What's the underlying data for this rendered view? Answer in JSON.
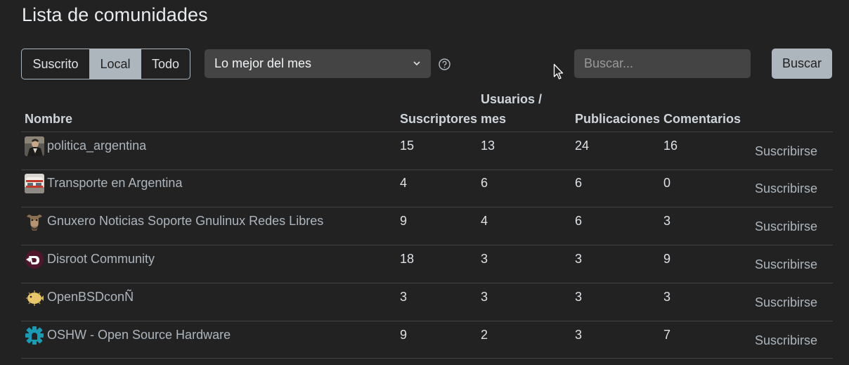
{
  "page": {
    "title": "Lista de comunidades"
  },
  "filter": {
    "options": [
      "Suscrito",
      "Local",
      "Todo"
    ],
    "selected": "Local"
  },
  "sort": {
    "value": "Lo mejor del mes"
  },
  "search": {
    "placeholder": "Buscar...",
    "button_label": "Buscar"
  },
  "table": {
    "headers": {
      "name": "Nombre",
      "subscribers": "Suscriptores",
      "users_month_line1": "Usuarios /",
      "users_month_line2": "mes",
      "posts": "Publicaciones",
      "comments": "Comentarios"
    },
    "rows": [
      {
        "name": "politica_argentina",
        "subscribers": "15",
        "users_month": "13",
        "posts": "24",
        "comments": "16",
        "action": "Suscribirse",
        "avatar": "portrait-avatar-icon"
      },
      {
        "name": "Transporte en Argentina",
        "subscribers": "4",
        "users_month": "6",
        "posts": "6",
        "comments": "0",
        "action": "Suscribirse",
        "avatar": "train-avatar-icon"
      },
      {
        "name": "Gnuxero Noticias Soporte Gnulinux Redes Libres",
        "subscribers": "9",
        "users_month": "4",
        "posts": "6",
        "comments": "3",
        "action": "Suscribirse",
        "avatar": "gnu-avatar-icon"
      },
      {
        "name": "Disroot Community",
        "subscribers": "18",
        "users_month": "3",
        "posts": "3",
        "comments": "9",
        "action": "Suscribirse",
        "avatar": "disroot-avatar-icon"
      },
      {
        "name": "OpenBSDconÑ",
        "subscribers": "3",
        "users_month": "3",
        "posts": "3",
        "comments": "3",
        "action": "Suscribirse",
        "avatar": "pufferfish-avatar-icon"
      },
      {
        "name": "OSHW - Open Source Hardware",
        "subscribers": "9",
        "users_month": "2",
        "posts": "3",
        "comments": "7",
        "action": "Suscribirse",
        "avatar": "gear-avatar-icon"
      }
    ]
  },
  "colors": {
    "background": "#222222",
    "control_bg": "#444444",
    "accent": "#adb5bd",
    "oshw_teal": "#1a9bb5"
  }
}
